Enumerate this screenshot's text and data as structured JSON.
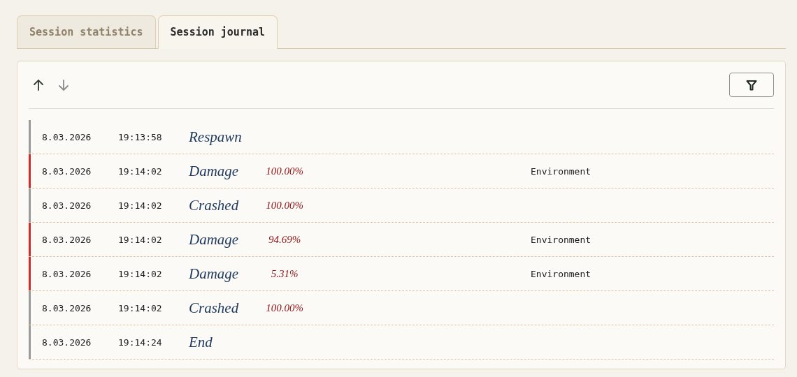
{
  "tabs": [
    {
      "label": "Session statistics",
      "selected": false
    },
    {
      "label": "Session journal",
      "selected": true
    }
  ],
  "sort_ascending": true,
  "rows": [
    {
      "color": "#9a9a9a",
      "date": "8.03.2026",
      "time": "19:13:58",
      "event": "Respawn"
    },
    {
      "color": "#d42a2a",
      "date": "8.03.2026",
      "time": "19:14:02",
      "event": "Damage",
      "value": "100.00%",
      "source": "Environment"
    },
    {
      "color": "#9a9a9a",
      "date": "8.03.2026",
      "time": "19:14:02",
      "event": "Crashed",
      "value": "100.00%"
    },
    {
      "color": "#d42a2a",
      "date": "8.03.2026",
      "time": "19:14:02",
      "event": "Damage",
      "value": "94.69%",
      "source": "Environment"
    },
    {
      "color": "#d42a2a",
      "date": "8.03.2026",
      "time": "19:14:02",
      "event": "Damage",
      "value": "5.31%",
      "source": "Environment"
    },
    {
      "color": "#9a9a9a",
      "date": "8.03.2026",
      "time": "19:14:02",
      "event": "Crashed",
      "value": "100.00%"
    },
    {
      "color": "#9a9a9a",
      "date": "8.03.2026",
      "time": "19:14:24",
      "event": "End"
    }
  ]
}
